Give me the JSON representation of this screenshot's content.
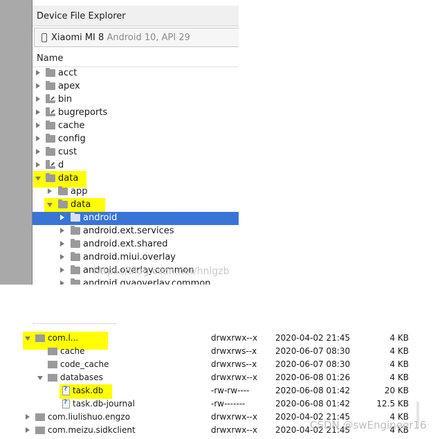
{
  "explorer": {
    "title": "Device File Explorer",
    "device_name": "Xiaomi MI 8",
    "device_meta": "Android 10, API 29",
    "column_name": "Name",
    "tree": [
      {
        "label": "acct"
      },
      {
        "label": "apex"
      },
      {
        "label": "bin"
      },
      {
        "label": "bugreports"
      },
      {
        "label": "cache"
      },
      {
        "label": "config"
      },
      {
        "label": "cust"
      },
      {
        "label": "d"
      },
      {
        "label": "data"
      },
      {
        "label": "app"
      },
      {
        "label": "data"
      },
      {
        "label": "android"
      },
      {
        "label": "android.ext.services"
      },
      {
        "label": "android.ext.shared"
      },
      {
        "label": "android.miui.overlay"
      },
      {
        "label": "android.overlay.common"
      },
      {
        "label": "android.qvaoverlay.common"
      }
    ]
  },
  "lower_list": {
    "rows": [
      {
        "name": "com.l...",
        "perm": "drwxrwx--x",
        "date": "2020-04-02 21:45",
        "size": "4 KB"
      },
      {
        "name": "cache",
        "perm": "drwxrws--x",
        "date": "2020-06-07 08:30",
        "size": "4 KB"
      },
      {
        "name": "code_cache",
        "perm": "drwxrws--x",
        "date": "2020-06-07 08:30",
        "size": "4 KB"
      },
      {
        "name": "databases",
        "perm": "drwxrwx--x",
        "date": "2020-06-08 01:26",
        "size": "4 KB"
      },
      {
        "name": "task.db",
        "perm": "-rw-rw----",
        "date": "2020-06-08 01:42",
        "size": "20 KB"
      },
      {
        "name": "task.db-journal",
        "perm": "-rw-------",
        "date": "2020-06-08 01:42",
        "size": "12.5 KB"
      },
      {
        "name": "com.liulishuo.engzo",
        "perm": "drwxrwx--x",
        "date": "2020-04-02 21:45",
        "size": "4 KB"
      },
      {
        "name": "com.meizu.sidkclient",
        "perm": "drwxrwx--x",
        "date": "2020-04-02 21:45",
        "size": "4 KB"
      }
    ]
  },
  "watermarks": {
    "top": "https://blog.csdn.net/hnlgzb",
    "bottom": "CSDN @swEngineer16"
  },
  "colors": {
    "highlight": "#ffff00",
    "selection": "#3875d7",
    "gutter": "#a9a9a9"
  }
}
